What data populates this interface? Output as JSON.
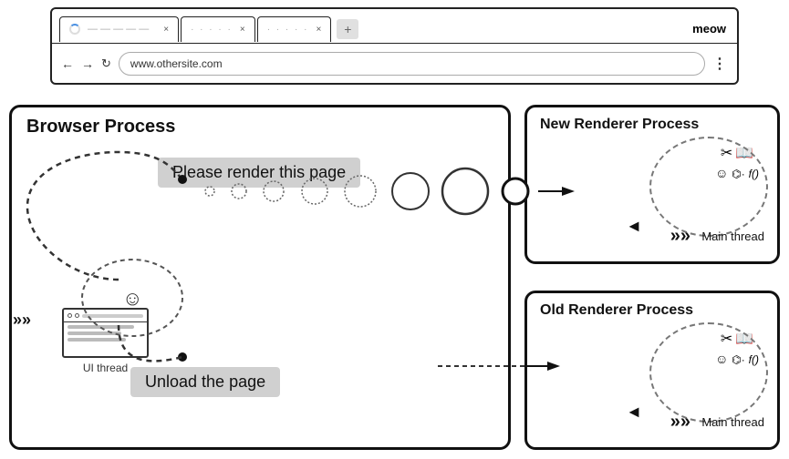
{
  "browser": {
    "tab1_dots": "○○○",
    "tab1_loading": "loading",
    "tab1_close": "×",
    "tab2_close": "×",
    "tab3_close": "×",
    "tab_meow": "meow",
    "address": "www.othersite.com",
    "nav_back": "←",
    "nav_forward": "→",
    "nav_refresh": "c",
    "nav_menu": "⋮"
  },
  "diagram": {
    "browser_process_label": "Browser Process",
    "new_renderer_label": "New Renderer Process",
    "old_renderer_label": "Old Renderer Process",
    "render_message": "Please render this page",
    "unload_message": "Unload the page",
    "ui_thread_label": "UI thread",
    "main_thread_label_1": "Main thread",
    "main_thread_label_2": "Main thread"
  }
}
